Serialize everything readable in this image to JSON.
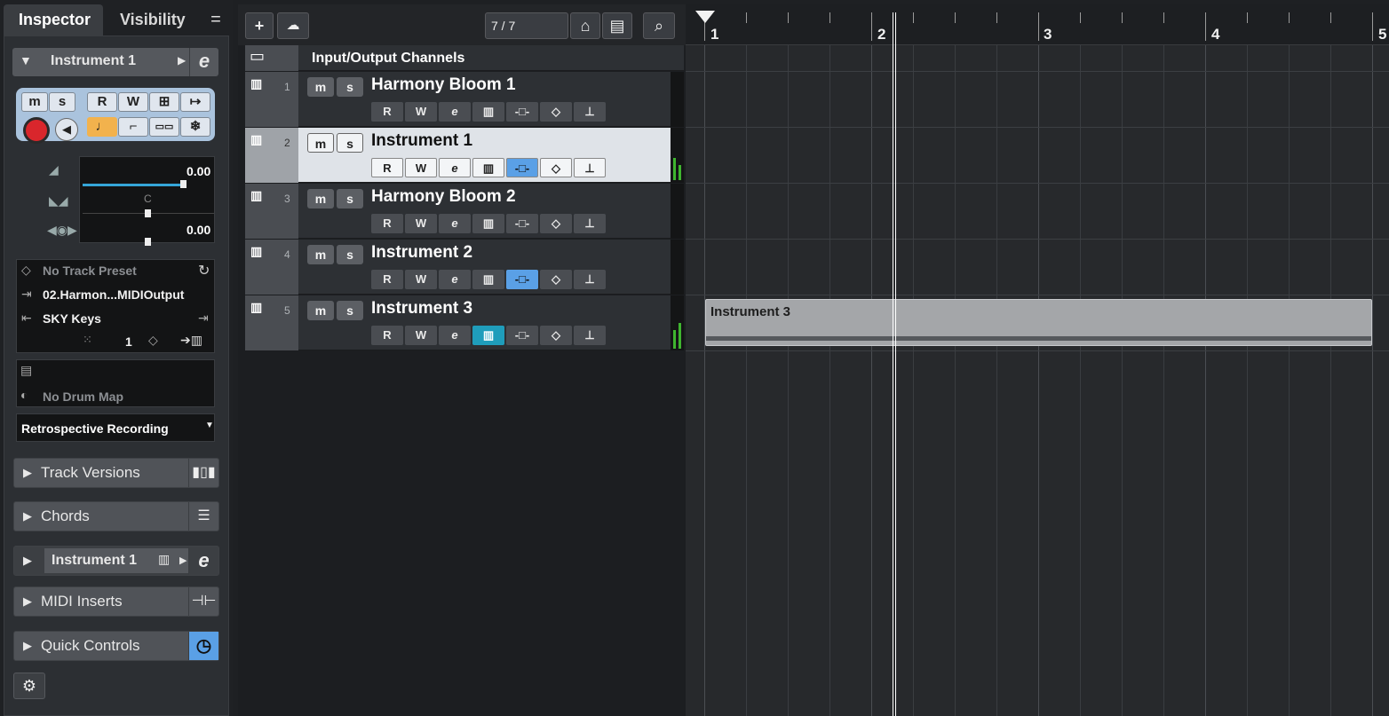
{
  "inspector": {
    "tabs": {
      "inspector": "Inspector",
      "visibility": "Visibility"
    },
    "menu_glyph": "=",
    "track_header": {
      "name": "Instrument 1",
      "arrow": "▶"
    },
    "ms": {
      "mute": "m",
      "solo": "s",
      "read": "R",
      "write": "W"
    },
    "volume_value": "0.00",
    "pan_label": "C",
    "delay_value": "0.00",
    "preset": "No Track Preset",
    "midi_input": "02.Harmon...MIDIOutput",
    "midi_output": "SKY Keys",
    "channel": "1",
    "drum_map": "No Drum Map",
    "retro_recording": "Retrospective Recording",
    "sections": [
      {
        "label": "Track Versions",
        "icon": "track-versions-icon"
      },
      {
        "label": "Chords",
        "icon": "chords-icon"
      },
      {
        "label": "Instrument 1",
        "icon": "edit-instrument-icon"
      },
      {
        "label": "MIDI Inserts",
        "icon": "inserts-icon"
      },
      {
        "label": "Quick Controls",
        "icon": "quick-controls-icon"
      }
    ]
  },
  "toolbar": {
    "add": "+",
    "track_count": "7 / 7"
  },
  "folder_track": {
    "name": "Input/Output Channels"
  },
  "tracks": [
    {
      "num": "1",
      "name": "Harmony Bloom 1",
      "mute": "m",
      "solo": "s",
      "read": "R",
      "write": "W",
      "selected": false
    },
    {
      "num": "2",
      "name": "Instrument 1",
      "mute": "m",
      "solo": "s",
      "read": "R",
      "write": "W",
      "selected": true
    },
    {
      "num": "3",
      "name": "Harmony Bloom 2",
      "mute": "m",
      "solo": "s",
      "read": "R",
      "write": "W",
      "selected": false
    },
    {
      "num": "4",
      "name": "Instrument 2",
      "mute": "m",
      "solo": "s",
      "read": "R",
      "write": "W",
      "selected": false
    },
    {
      "num": "5",
      "name": "Instrument 3",
      "mute": "m",
      "solo": "s",
      "read": "R",
      "write": "W",
      "selected": false
    }
  ],
  "ruler": {
    "bars": [
      "1",
      "2",
      "3",
      "4",
      "5"
    ]
  },
  "event": {
    "name": "Instrument 3"
  },
  "colors": {
    "accent_blue": "#5aa0e6",
    "record_red": "#d9262c",
    "selected_track": "#dfe3e8",
    "meter_green": "#3fb52f"
  }
}
